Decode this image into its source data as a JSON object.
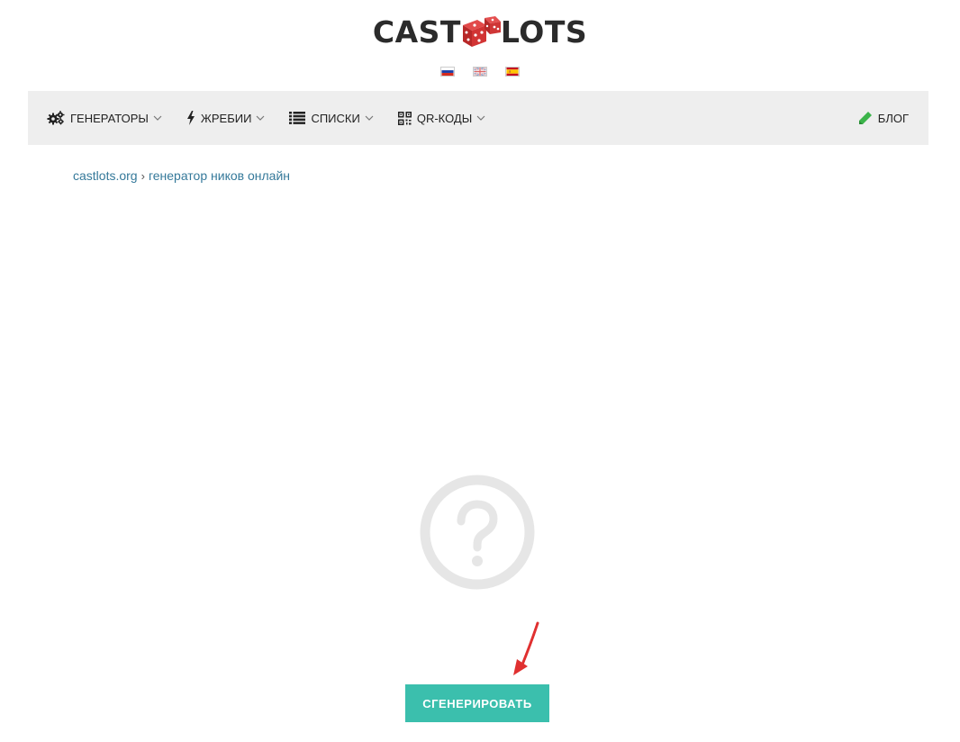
{
  "logo": {
    "part1": "CAST",
    "part2": "LOTS"
  },
  "languages": [
    {
      "code": "ru",
      "icon": "russia-flag"
    },
    {
      "code": "en",
      "icon": "uk-flag"
    },
    {
      "code": "es",
      "icon": "spain-flag"
    }
  ],
  "nav": {
    "items": [
      {
        "label": "ГЕНЕРАТОРЫ",
        "icon": "gears-icon"
      },
      {
        "label": "ЖРЕБИИ",
        "icon": "lightning-icon"
      },
      {
        "label": "СПИСКИ",
        "icon": "list-icon"
      },
      {
        "label": "QR-КОДЫ",
        "icon": "qr-code-icon"
      }
    ],
    "blog": {
      "label": "БЛОГ",
      "icon": "pencil-icon"
    }
  },
  "breadcrumb": {
    "home": "castlots.org",
    "separator": "›",
    "current": "генератор ников онлайн"
  },
  "result": {
    "icon": "question-circle-icon"
  },
  "generate_button": {
    "label": "СГЕНЕРИРОВАТЬ"
  },
  "colors": {
    "accent": "#3bbfad",
    "link": "#35799a",
    "navbar_bg": "#eeeeee",
    "arrow": "#e03030",
    "blog_icon": "#3cb44a"
  }
}
